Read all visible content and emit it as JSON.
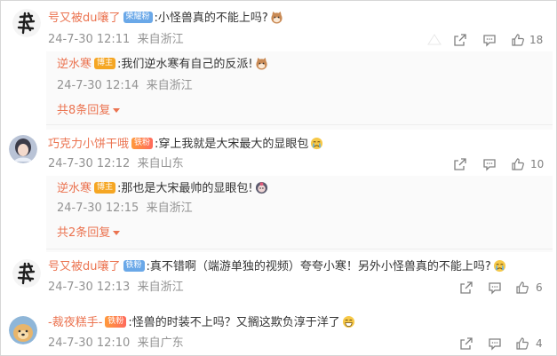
{
  "colors": {
    "username": "#eb7350",
    "meta": "#939393",
    "text": "#333333"
  },
  "comments": [
    {
      "user": "号又被du嚷了",
      "badge": "荣耀粉",
      "text": ":小怪兽真的不能上吗?",
      "emoji": "cat-face-emoji",
      "time": "24-7-30 12:11",
      "location": "来自浙江",
      "likes": "18",
      "avatar": "calligraphy-avatar",
      "replies": [
        {
          "user": "逆水寒",
          "badge": "博主",
          "text": ":我们逆水寒有自己的反派!",
          "emoji": "cat-face-emoji",
          "time": "24-7-30 12:14",
          "location": "来自浙江"
        }
      ],
      "reply_link": "共8条回复"
    },
    {
      "user": "巧克力小饼干哦",
      "badge": "铁粉",
      "text": ":穿上我就是大宋最大的显眼包",
      "emoji": "crying-emoji",
      "time": "24-7-30 12:12",
      "location": "来自山东",
      "likes": "10",
      "avatar": "girl-avatar",
      "replies": [
        {
          "user": "逆水寒",
          "badge": "博主",
          "text": ":那也是大宋最帅的显眼包!",
          "emoji": "sticker-emoji",
          "time": "24-7-30 12:15",
          "location": "来自浙江"
        }
      ],
      "reply_link": "共2条回复"
    },
    {
      "user": "号又被du嚷了",
      "badge": "铁粉",
      "text": ":真不错啊（端游单独的视频）夸夸小寒！另外小怪兽真的不能上吗?",
      "emoji": "crying-emoji",
      "time": "24-7-30 12:13",
      "location": "来自浙江",
      "likes": "6",
      "avatar": "calligraphy-avatar",
      "replies": [],
      "reply_link": ""
    },
    {
      "user": "-裁夜糕手-",
      "badge": "铁粉",
      "text": ":怪兽的时装不上吗？又搁这欺负淳于洋了",
      "emoji": "grin-emoji",
      "time": "24-7-30 12:10",
      "location": "来自广东",
      "likes": "4",
      "avatar": "dog-avatar",
      "replies": [],
      "reply_link": ""
    }
  ]
}
